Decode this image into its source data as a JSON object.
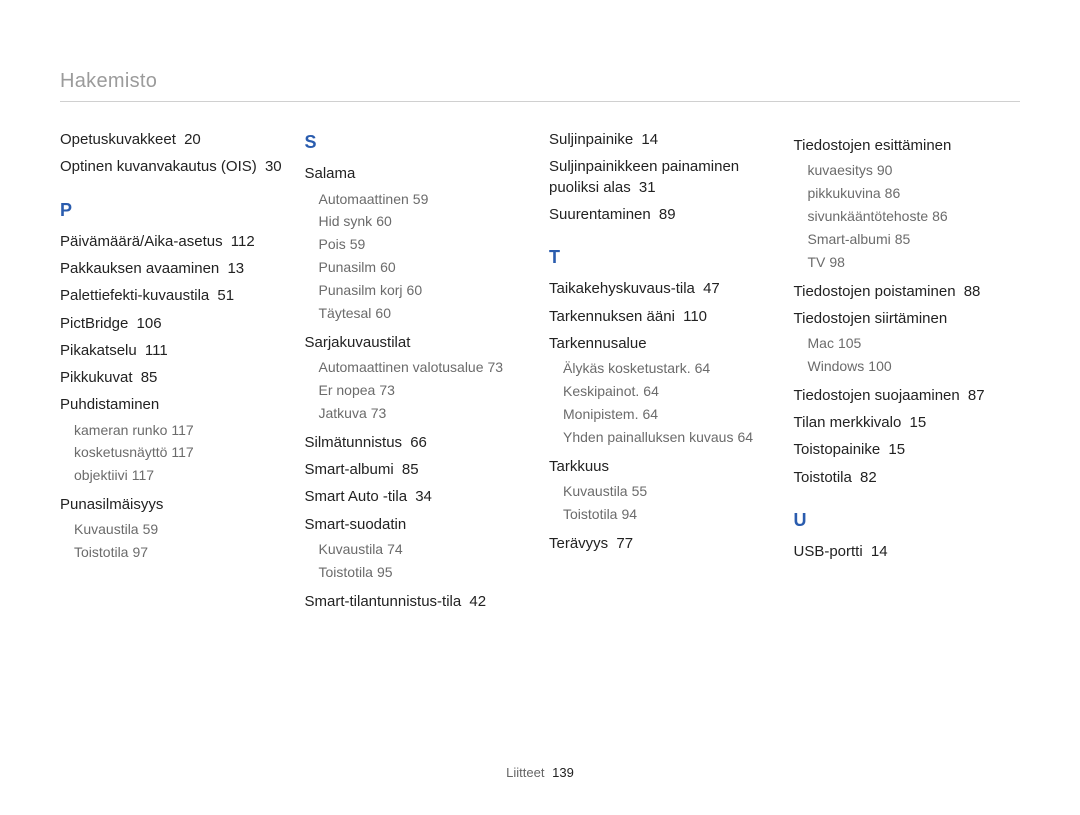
{
  "header": {
    "title": "Hakemisto"
  },
  "footer": {
    "label": "Liitteet",
    "page": "139"
  },
  "col1": {
    "opetuskuvakkeet": {
      "label": "Opetuskuvakkeet",
      "pg": "20"
    },
    "ois": {
      "label": "Optinen kuvanvakautus (OIS)",
      "pg": "30"
    },
    "letter": "P",
    "paiva": {
      "label": "Päivämäärä/Aika-asetus",
      "pg": "112"
    },
    "pakkaus": {
      "label": "Pakkauksen avaaminen",
      "pg": "13"
    },
    "paletti": {
      "label": "Palettiefekti-kuvaustila",
      "pg": "51"
    },
    "pictbridge": {
      "label": "PictBridge",
      "pg": "106"
    },
    "pikakatselu": {
      "label": "Pikakatselu",
      "pg": "111"
    },
    "pikkukuvat": {
      "label": "Pikkukuvat",
      "pg": "85"
    },
    "puhdistaminen": {
      "label": "Puhdistaminen"
    },
    "puhd_sub": [
      {
        "label": "kameran runko",
        "pg": "117"
      },
      {
        "label": "kosketusnäyttö",
        "pg": "117"
      },
      {
        "label": "objektiivi",
        "pg": "117"
      }
    ],
    "punasilm": {
      "label": "Punasilmäisyys"
    },
    "punasilm_sub": [
      {
        "label": "Kuvaustila",
        "pg": "59"
      },
      {
        "label": "Toistotila",
        "pg": "97"
      }
    ]
  },
  "col2": {
    "letter": "S",
    "salama": {
      "label": "Salama"
    },
    "salama_sub": [
      {
        "label": "Automaattinen",
        "pg": "59"
      },
      {
        "label": "Hid synk",
        "pg": "60"
      },
      {
        "label": "Pois",
        "pg": "59"
      },
      {
        "label": "Punasilm",
        "pg": "60"
      },
      {
        "label": "Punasilm korj",
        "pg": "60"
      },
      {
        "label": "Täytesal",
        "pg": "60"
      }
    ],
    "sarja": {
      "label": "Sarjakuvaustilat"
    },
    "sarja_sub": [
      {
        "label": "Automaattinen valotusalue",
        "pg": "73"
      },
      {
        "label": "Er nopea",
        "pg": "73"
      },
      {
        "label": "Jatkuva",
        "pg": "73"
      }
    ],
    "silma": {
      "label": "Silmätunnistus",
      "pg": "66"
    },
    "smartalbumi": {
      "label": "Smart-albumi",
      "pg": "85"
    },
    "smartauto": {
      "label": "Smart Auto -tila",
      "pg": "34"
    },
    "smartsuodatin": {
      "label": "Smart-suodatin"
    },
    "smartsuodatin_sub": [
      {
        "label": "Kuvaustila",
        "pg": "74"
      },
      {
        "label": "Toistotila",
        "pg": "95"
      }
    ],
    "smarttila": {
      "label": "Smart-tilantunnistus-tila",
      "pg": "42"
    }
  },
  "col3": {
    "suljinpainike": {
      "label": "Suljinpainike",
      "pg": "14"
    },
    "suljinpuoliksi": {
      "label": "Suljinpainikkeen painaminen puoliksi alas",
      "pg": "31"
    },
    "suurentaminen": {
      "label": "Suurentaminen",
      "pg": "89"
    },
    "letter": "T",
    "taika": {
      "label": "Taikakehyskuvaus-tila",
      "pg": "47"
    },
    "tarkaani": {
      "label": "Tarkennuksen ääni",
      "pg": "110"
    },
    "tarkalue": {
      "label": "Tarkennusalue"
    },
    "tarkalue_sub": [
      {
        "label": "Älykäs kosketustark.",
        "pg": "64"
      },
      {
        "label": "Keskipainot.",
        "pg": "64"
      },
      {
        "label": "Monipistem.",
        "pg": "64"
      },
      {
        "label": "Yhden painalluksen kuvaus",
        "pg": "64"
      }
    ],
    "tarkkuus": {
      "label": "Tarkkuus"
    },
    "tarkkuus_sub": [
      {
        "label": "Kuvaustila",
        "pg": "55"
      },
      {
        "label": "Toistotila",
        "pg": "94"
      }
    ],
    "teravyys": {
      "label": "Terävyys",
      "pg": "77"
    }
  },
  "col4": {
    "esittaminen": {
      "label": "Tiedostojen esittäminen"
    },
    "esittaminen_sub": [
      {
        "label": "kuvaesitys",
        "pg": "90"
      },
      {
        "label": "pikkukuvina",
        "pg": "86"
      },
      {
        "label": "sivunkääntötehoste",
        "pg": "86"
      },
      {
        "label": "Smart-albumi",
        "pg": "85"
      },
      {
        "label": "TV",
        "pg": "98"
      }
    ],
    "poist": {
      "label": "Tiedostojen poistaminen",
      "pg": "88"
    },
    "siirt": {
      "label": "Tiedostojen siirtäminen"
    },
    "siirt_sub": [
      {
        "label": "Mac",
        "pg": "105"
      },
      {
        "label": "Windows",
        "pg": "100"
      }
    ],
    "suoj": {
      "label": "Tiedostojen suojaaminen",
      "pg": "87"
    },
    "merkkivalo": {
      "label": "Tilan merkkivalo",
      "pg": "15"
    },
    "toistopainike": {
      "label": "Toistopainike",
      "pg": "15"
    },
    "toistotila": {
      "label": "Toistotila",
      "pg": "82"
    },
    "letter": "U",
    "usb": {
      "label": "USB-portti",
      "pg": "14"
    }
  }
}
